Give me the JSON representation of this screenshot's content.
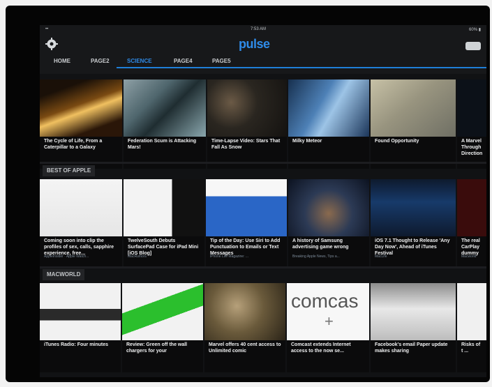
{
  "status": {
    "time": "7:53 AM",
    "left": "•• ",
    "right": "60% ▮"
  },
  "app": {
    "brand": "pulse"
  },
  "tabs": [
    {
      "label": "HOME",
      "active": false
    },
    {
      "label": "PAGE2",
      "active": false
    },
    {
      "label": "SCIENCE",
      "active": true
    },
    {
      "label": "PAGE4",
      "active": false
    },
    {
      "label": "PAGE5",
      "active": false
    }
  ],
  "sections": [
    {
      "label": "",
      "cards": [
        {
          "title": "The Cycle of Life, From a Caterpillar to a Galaxy",
          "sub": "",
          "tone": "fire"
        },
        {
          "title": "Federation Scum is Attacking Mars!",
          "sub": "",
          "tone": "ice"
        },
        {
          "title": "Time-Lapse Video: Stars That Fall As Snow",
          "sub": "",
          "tone": "space"
        },
        {
          "title": "Milky Meteor",
          "sub": "",
          "tone": "blue"
        },
        {
          "title": "Found Opportunity",
          "sub": "",
          "tone": "sand"
        },
        {
          "title": "A Marvel Through Direction",
          "sub": "",
          "tone": "dark"
        }
      ]
    },
    {
      "label": "BEST OF APPLE",
      "cards": [
        {
          "title": "Coming soon into clip the profiles of sex, calls, sapphire experience, free...",
          "sub": "AppleInsider · Apple Watch...",
          "tone": "white"
        },
        {
          "title": "TwelveSouth Debuts SurfacePad Case for iPad Mini [iOS Blog]",
          "sub": "MacRumors",
          "tone": "keys"
        },
        {
          "title": "Tip of the Day: Use Siri to Add Punctuation to Emails or Text Messages",
          "sub": "iPhone Life Magazine: ...",
          "tone": "pyramid"
        },
        {
          "title": "A history of Samsung advertising game wrong",
          "sub": "Breaking Apple News, Tips a...",
          "tone": "crowd"
        },
        {
          "title": "iOS 7.1 Thought to Release 'Any Day Now', Ahead of iTunes Festival",
          "sub": "MacLife",
          "tone": "navy"
        },
        {
          "title": "The real CarPlay dummy",
          "sub": "Macworld",
          "tone": "dark"
        }
      ]
    },
    {
      "label": "MACWORLD",
      "cards": [
        {
          "title": "iTunes Radio: Four minutes",
          "sub": "",
          "tone": "white"
        },
        {
          "title": "Review: Green off the wall chargers for your",
          "sub": "",
          "tone": "green"
        },
        {
          "title": "Marvel offers 40 cent access to Unlimited comic",
          "sub": "",
          "tone": "comic"
        },
        {
          "title": "Comcast extends Internet access to the now se...",
          "sub": "",
          "tone": "comcast"
        },
        {
          "title": "Facebook's email Paper update makes sharing",
          "sub": "",
          "tone": "phone"
        },
        {
          "title": "Risks of t ...",
          "sub": "",
          "tone": "white"
        }
      ]
    }
  ],
  "labels": {
    "comcast_text": "comcas",
    "comcast_plus": "+"
  }
}
